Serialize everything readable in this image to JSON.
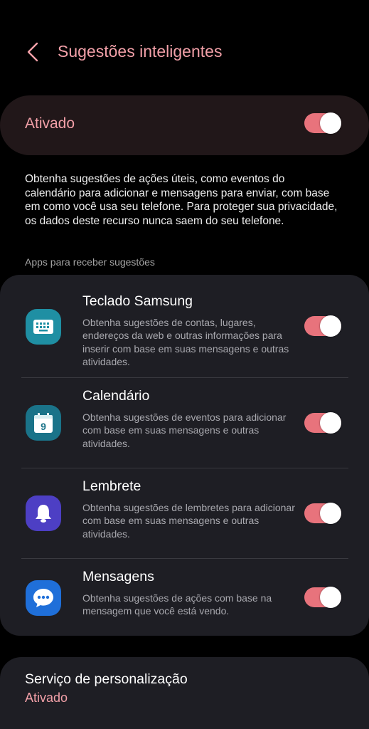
{
  "header": {
    "title": "Sugestões inteligentes",
    "back_icon": "chevron-left-icon"
  },
  "master_toggle": {
    "label": "Ativado",
    "state": "on"
  },
  "description": "Obtenha sugestões de ações úteis, como eventos do calendário para adicionar e mensagens para enviar, com base em como você usa seu telefone. Para proteger sua privacidade, os dados deste recurso nunca saem do seu telefone.",
  "section_label": "Apps para receber sugestões",
  "apps": [
    {
      "title": "Teclado Samsung",
      "description": "Obtenha sugestões de contas, lugares, endereços da web e outras informações para inserir com base em suas mensagens e outras atividades.",
      "icon": "keyboard-icon",
      "state": "on"
    },
    {
      "title": "Calendário",
      "description": "Obtenha sugestões de eventos para adicionar com base em suas mensagens e outras atividades.",
      "icon": "calendar-icon",
      "icon_text": "9",
      "state": "on"
    },
    {
      "title": "Lembrete",
      "description": "Obtenha sugestões de lembretes para adicionar com base em suas mensagens e outras atividades.",
      "icon": "bell-icon",
      "state": "on"
    },
    {
      "title": "Mensagens",
      "description": "Obtenha sugestões de ações com base na mensagem que você está vendo.",
      "icon": "message-bubble-icon",
      "state": "on"
    }
  ],
  "personalization": {
    "title": "Serviço de personalização",
    "status": "Ativado"
  },
  "colors": {
    "accent": "#f2a0a8",
    "toggle_track": "#e8737c",
    "card_bg": "#1e1e24",
    "master_card_bg": "#211719",
    "keyboard_icon_bg": "#1f8fa3",
    "calendar_icon_bg": "#1a7389",
    "reminder_icon_bg": "#4d3fc4",
    "messages_icon_bg": "#1f6fd9"
  }
}
